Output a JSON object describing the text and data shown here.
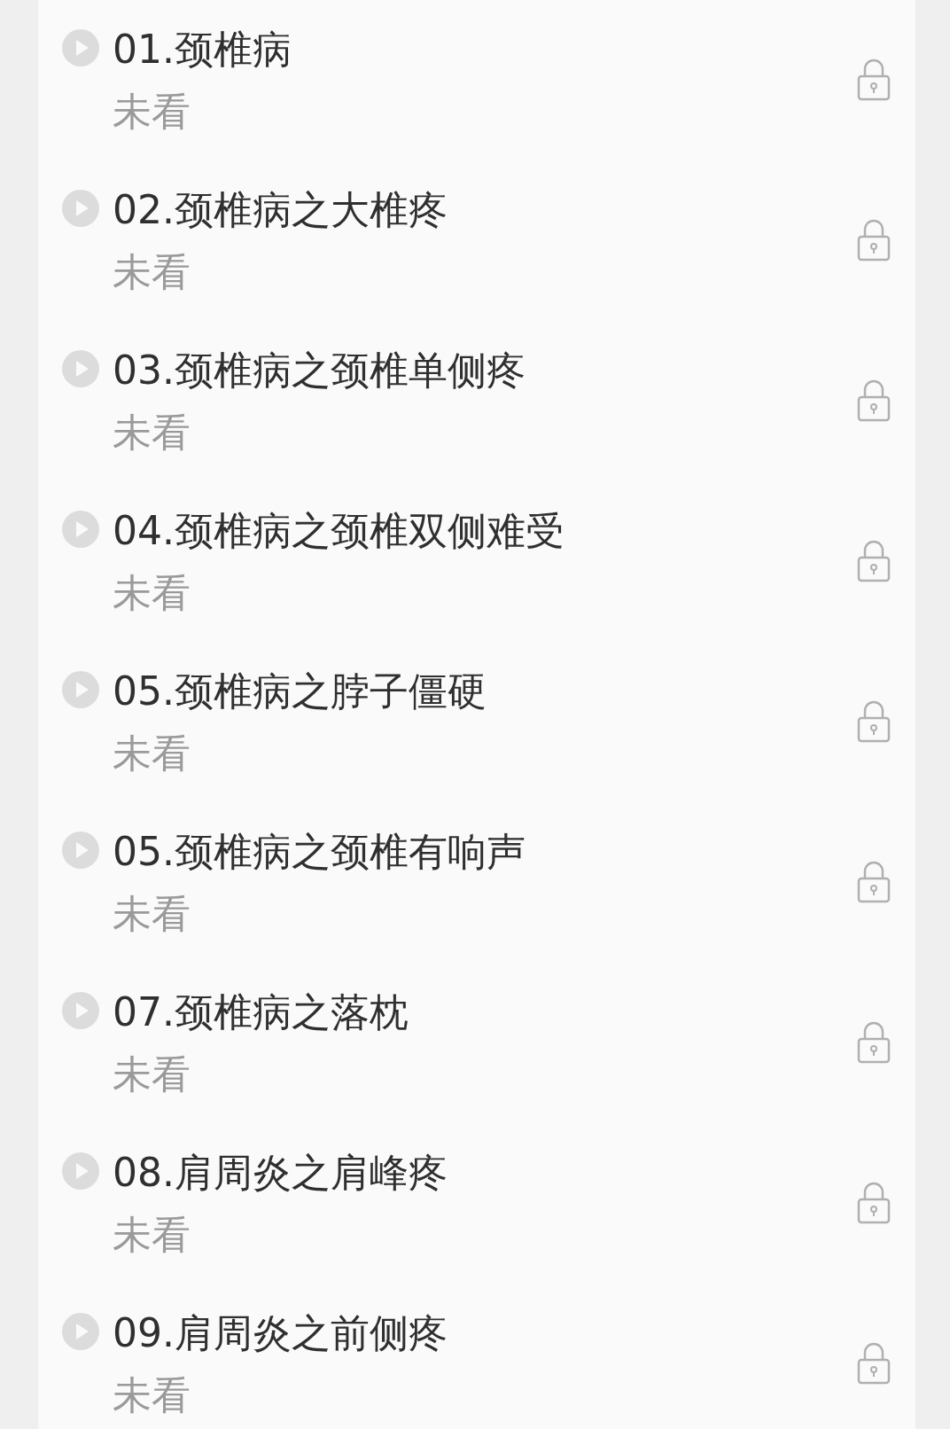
{
  "lessons": [
    {
      "title": "01.颈椎病",
      "status": "未看",
      "locked": true
    },
    {
      "title": "02.颈椎病之大椎疼",
      "status": "未看",
      "locked": true
    },
    {
      "title": "03.颈椎病之颈椎单侧疼",
      "status": "未看",
      "locked": true
    },
    {
      "title": "04.颈椎病之颈椎双侧难受",
      "status": "未看",
      "locked": true
    },
    {
      "title": "05.颈椎病之脖子僵硬",
      "status": "未看",
      "locked": true
    },
    {
      "title": "05.颈椎病之颈椎有响声",
      "status": "未看",
      "locked": true
    },
    {
      "title": "07.颈椎病之落枕",
      "status": "未看",
      "locked": true
    },
    {
      "title": "08.肩周炎之肩峰疼",
      "status": "未看",
      "locked": true
    },
    {
      "title": "09.肩周炎之前侧疼",
      "status": "未看",
      "locked": true
    }
  ]
}
